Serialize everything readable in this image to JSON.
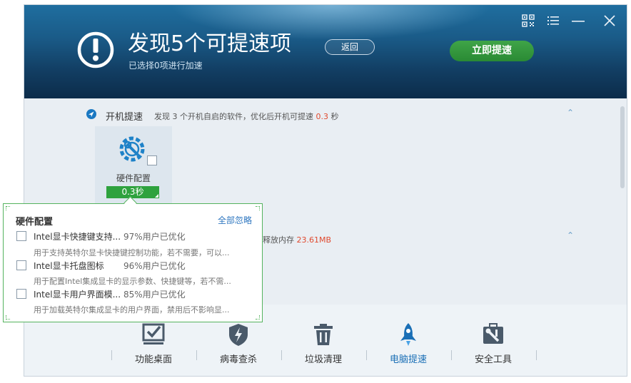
{
  "header": {
    "title": "发现5个可提速项",
    "subtitle": "已选择0项进行加速",
    "back_label": "返回",
    "speedup_label": "立即提速",
    "icons": [
      "qrcode-icon",
      "menu-icon",
      "minimize-icon",
      "close-icon"
    ]
  },
  "sections": {
    "startup": {
      "title": "开机提速",
      "desc_before": "发现 3 个开机自启的软件，优化后开机可提速 ",
      "value": "0.3",
      "unit": " 秒"
    },
    "memory": {
      "desc_before": "释放内存 ",
      "value": "23.61MB"
    }
  },
  "card": {
    "label": "硬件配置",
    "badge": "0.3秒"
  },
  "popup": {
    "title": "硬件配置",
    "ignore_all": "全部忽略",
    "items": [
      {
        "name": "Intel显卡快捷键支持...",
        "pct": "97%用户已优化",
        "desc": "用于支持英特尔显卡快捷键控制功能，若不需要，可以..."
      },
      {
        "name": "Intel显卡托盘图标",
        "pct": "96%用户已优化",
        "desc": "用于配置Intel集成显卡的显示参数、快捷键等，若不需..."
      },
      {
        "name": "Intel显卡用户界面模...",
        "pct": "85%用户已优化",
        "desc": "用于加载英特尔集成显卡的用户界面，禁用后不影响显..."
      }
    ]
  },
  "nav": {
    "items": [
      {
        "label": "功能桌面",
        "icon": "desktop-check-icon"
      },
      {
        "label": "病毒查杀",
        "icon": "shield-lightning-icon"
      },
      {
        "label": "垃圾清理",
        "icon": "trash-icon"
      },
      {
        "label": "电脑提速",
        "icon": "rocket-icon"
      },
      {
        "label": "安全工具",
        "icon": "toolbox-icon"
      }
    ],
    "active_index": 3
  },
  "colors": {
    "accent_green": "#2ea23e",
    "accent_blue": "#1a6fb6",
    "highlight_red": "#e04a2f"
  }
}
